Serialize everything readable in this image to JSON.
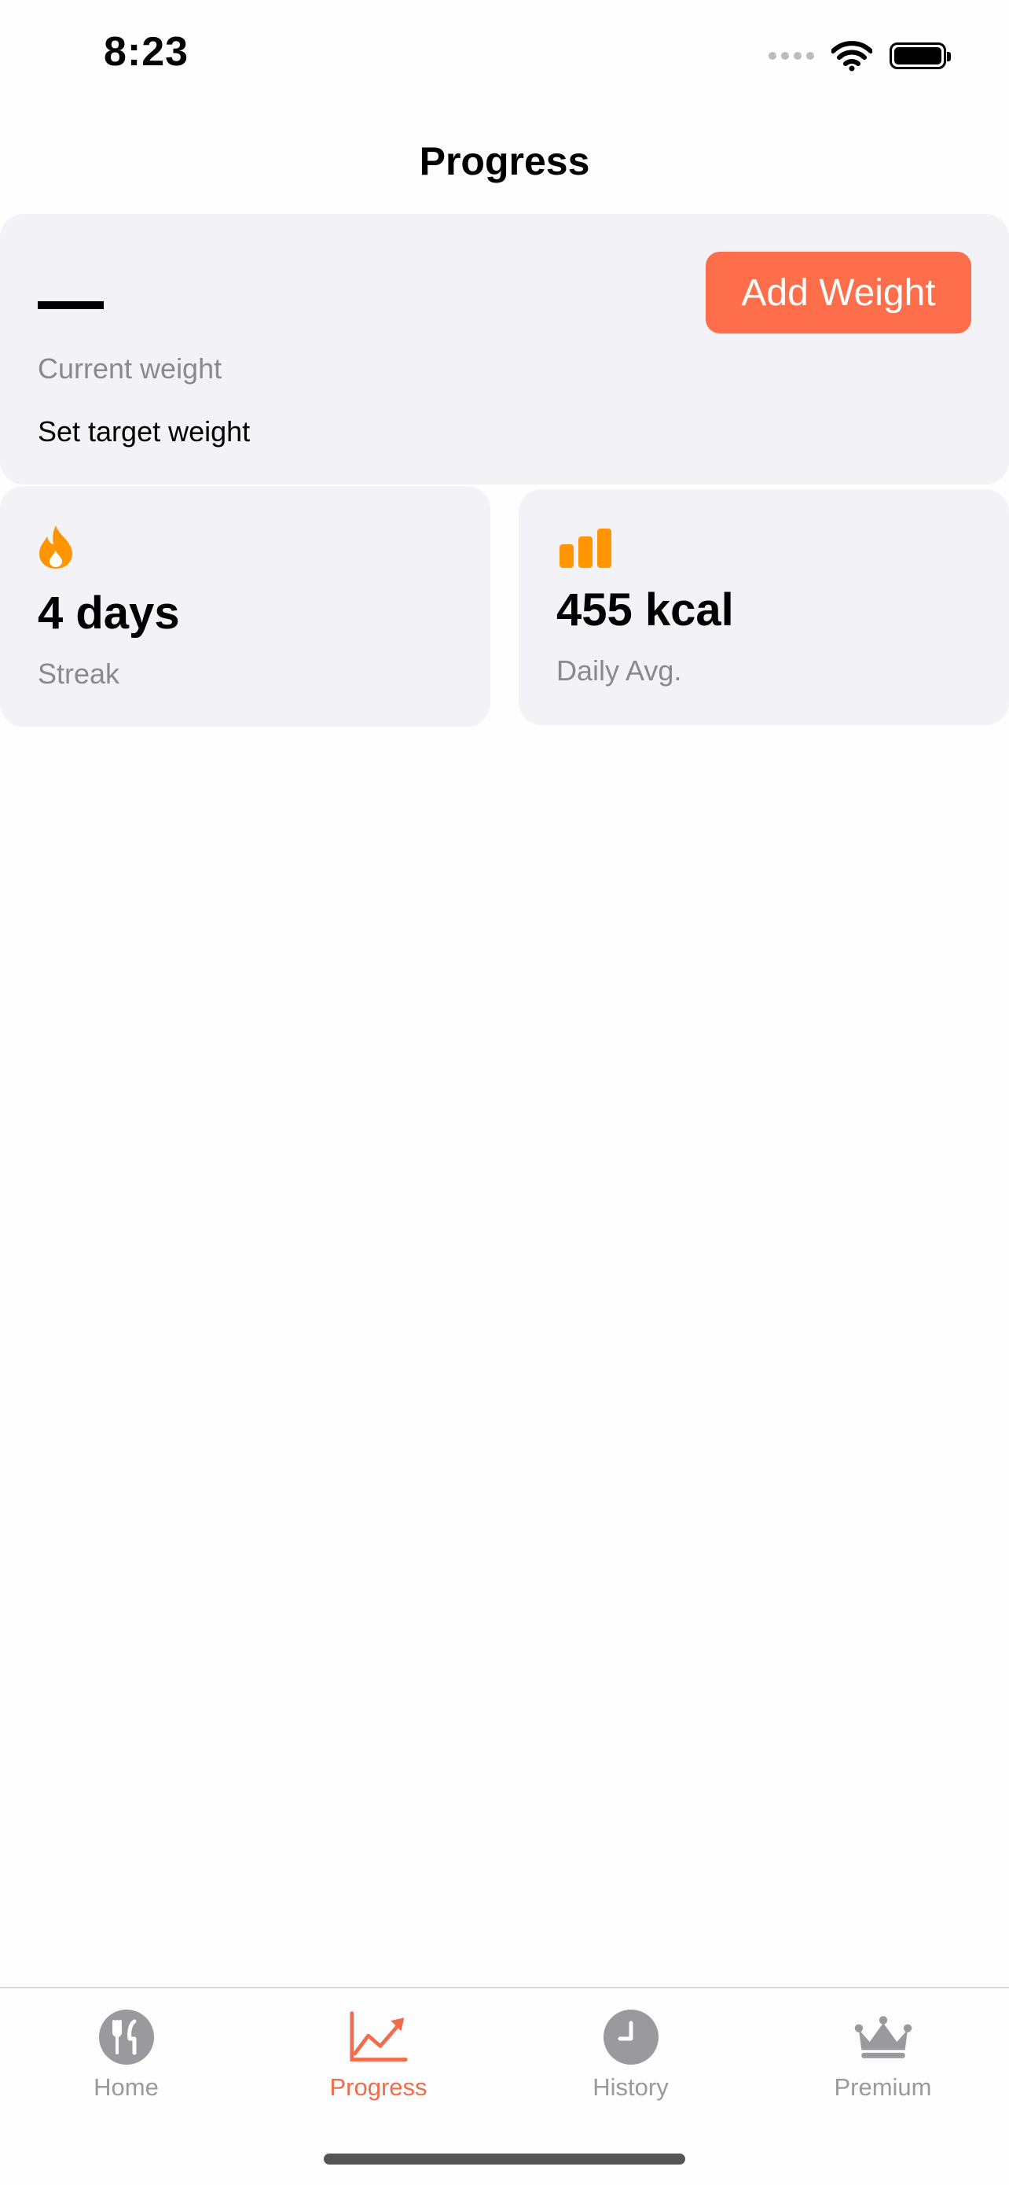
{
  "status_bar": {
    "time": "8:23",
    "icons": [
      "signal-icon",
      "wifi-icon",
      "battery-icon"
    ]
  },
  "page": {
    "title": "Progress"
  },
  "weight_card": {
    "current_value": "—",
    "current_label": "Current weight",
    "target_link": "Set target weight",
    "add_button": "Add Weight"
  },
  "stats": {
    "streak": {
      "icon": "flame-icon",
      "value": "4 days",
      "label": "Streak"
    },
    "daily_avg": {
      "icon": "bar-chart-icon",
      "value": "455 kcal",
      "label": "Daily Avg."
    }
  },
  "tab_bar": {
    "tabs": [
      {
        "label": "Home",
        "icon": "fork-knife-icon",
        "active": false
      },
      {
        "label": "Progress",
        "icon": "trend-chart-icon",
        "active": true
      },
      {
        "label": "History",
        "icon": "clock-icon",
        "active": false
      },
      {
        "label": "Premium",
        "icon": "crown-icon",
        "active": false
      }
    ]
  },
  "colors": {
    "accent": "#ff6e4a",
    "tab_active": "#f26b4b",
    "stat_icon": "#ff9500",
    "card_bg": "#f2f2f7",
    "secondary_text": "#8a8a8e"
  }
}
